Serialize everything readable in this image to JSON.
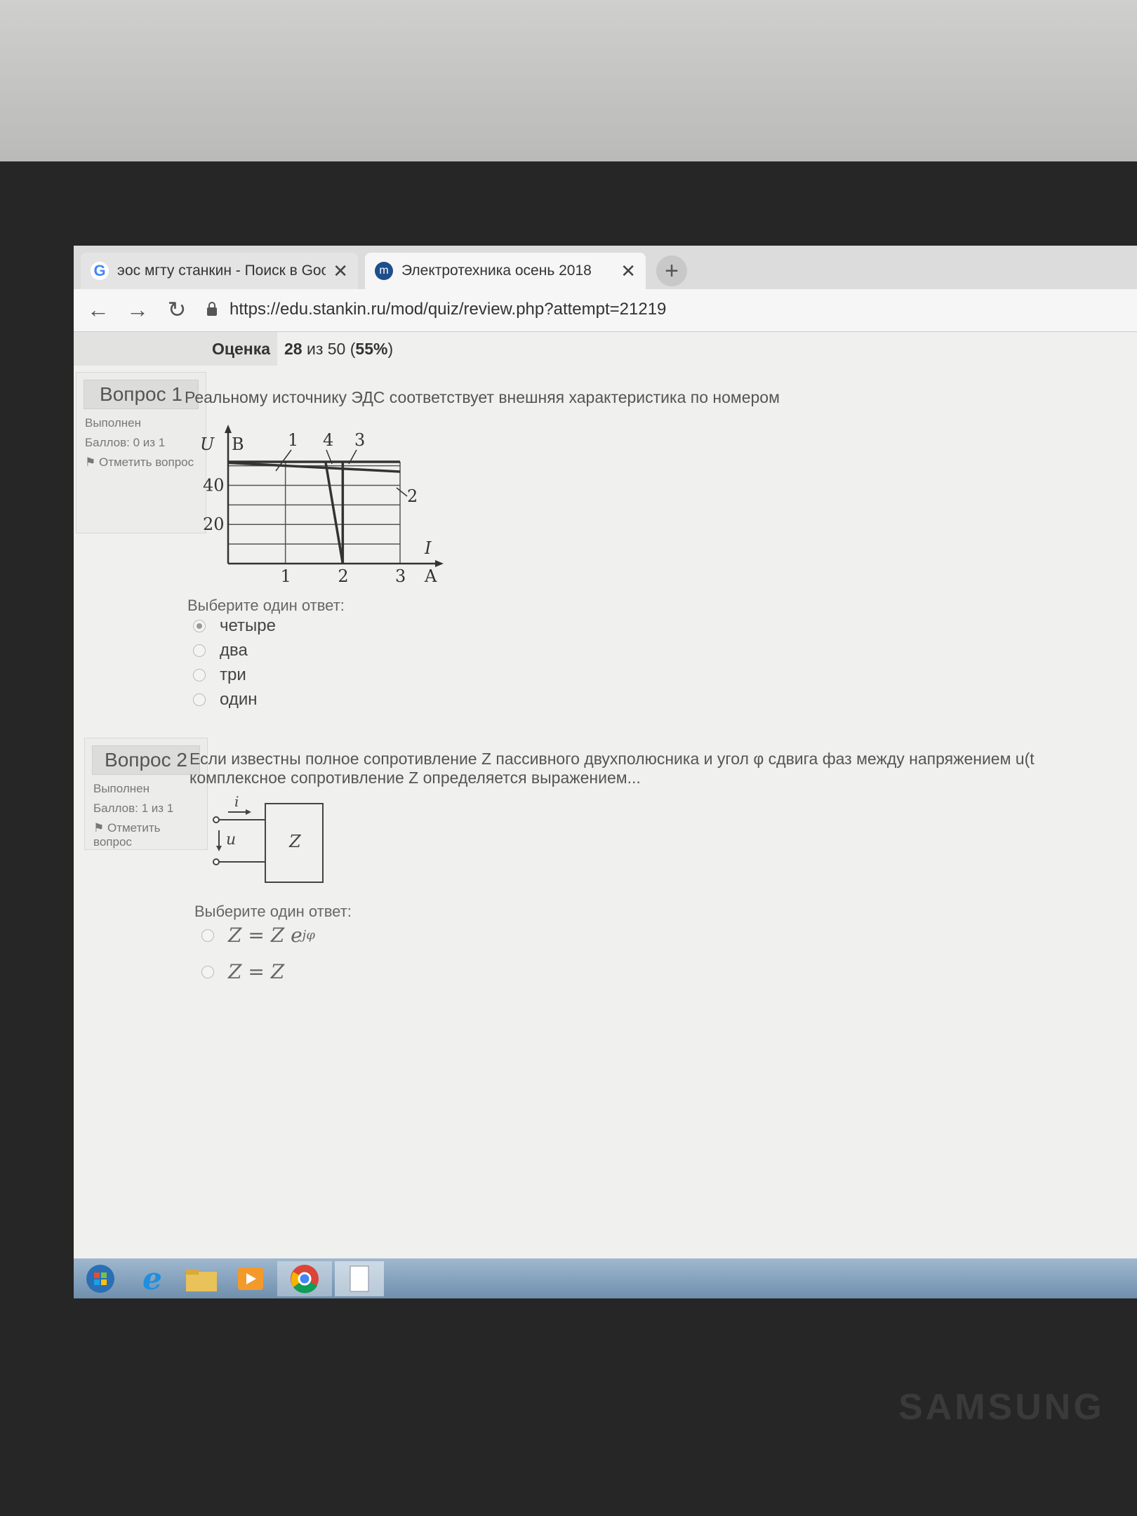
{
  "browser": {
    "tabs": [
      {
        "title": "эос мгту станкин - Поиск в Goo",
        "close": "✕"
      },
      {
        "title": "Электротехника осень 2018",
        "close": "✕"
      }
    ],
    "new_tab": "+",
    "url": "https://edu.stankin.ru/mod/quiz/review.php?attempt=21219"
  },
  "summary": {
    "label": "Оценка",
    "score": "28",
    "mid": "из 50 (",
    "percent": "55%",
    "end": ")"
  },
  "questions": [
    {
      "number": "Вопрос 1",
      "status": "Выполнен",
      "points": "Баллов: 0 из 1",
      "flag": "Отметить вопрос",
      "text": "Реальному источнику ЭДС соответствует внешняя характеристика по номером",
      "prompt": "Выберите один ответ:",
      "options": [
        "четыре",
        "два",
        "три",
        "один"
      ],
      "selected_index": 0
    },
    {
      "number": "Вопрос 2",
      "status": "Выполнен",
      "points": "Баллов: 1 из 1",
      "flag": "Отметить вопрос",
      "text_line1": "Если известны полное сопротивление Z пассивного двухполюсника и угол φ сдвига фаз между напряжением u(t",
      "text_line2": "комплексное сопротивление Z определяется выражением...",
      "prompt": "Выберите один ответ:",
      "options": [
        "Z = Z e",
        "Z = Z"
      ],
      "option1_sup": "jφ"
    }
  ],
  "chart_data": {
    "type": "line",
    "xlabel": "I",
    "x_unit": "A",
    "ylabel": "U",
    "y_unit": "B",
    "x_ticks": [
      "1",
      "2",
      "3"
    ],
    "y_ticks": [
      "20",
      "40"
    ],
    "xlim": [
      0,
      3.5
    ],
    "ylim": [
      0,
      55
    ],
    "series": [
      {
        "name": "1",
        "x": [
          0,
          3
        ],
        "y": [
          52,
          52
        ]
      },
      {
        "name": "2",
        "x": [
          0,
          3
        ],
        "y": [
          51.5,
          47
        ]
      },
      {
        "name": "3",
        "x": [
          2,
          2
        ],
        "y": [
          0,
          52
        ]
      },
      {
        "name": "4",
        "x": [
          1.7,
          2
        ],
        "y": [
          52,
          0
        ]
      }
    ]
  },
  "circuit": {
    "current": "i",
    "voltage": "u",
    "element": "Z"
  },
  "colors": {
    "page": "#f0f0ee",
    "panel": "#ececea",
    "taskbar": "#7f9cba"
  },
  "taskbar_icons": [
    "start-orb-icon",
    "ie-icon",
    "folder-icon",
    "media-icon",
    "chrome-icon",
    "document-icon"
  ],
  "brand": "SAMSUNG"
}
